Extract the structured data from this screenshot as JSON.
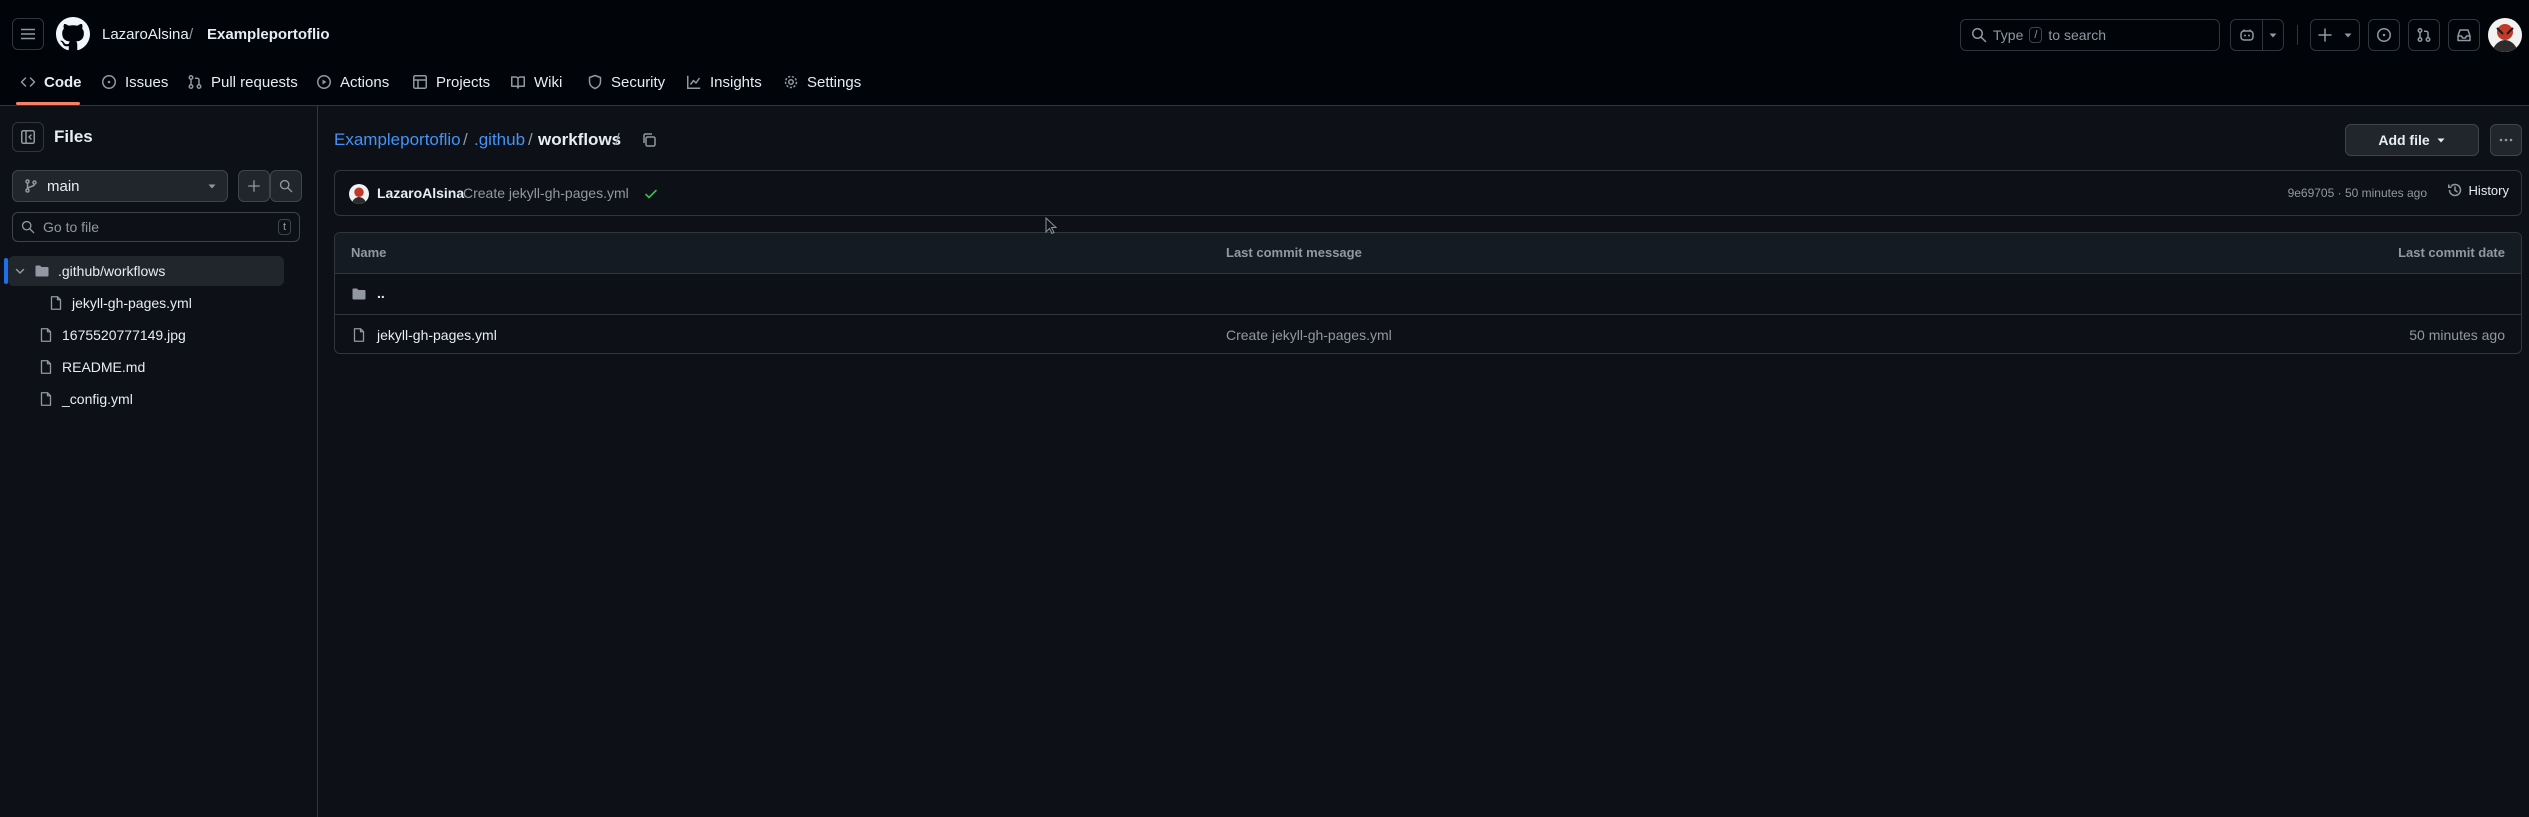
{
  "header": {
    "owner": "LazaroAlsina",
    "separator": "/",
    "repo": "Exampleportoflio",
    "search": {
      "prefix": "Type",
      "key": "/",
      "suffix": "to search"
    }
  },
  "nav": {
    "tabs": [
      {
        "label": "Code",
        "icon": "code-icon"
      },
      {
        "label": "Issues",
        "icon": "issue-icon"
      },
      {
        "label": "Pull requests",
        "icon": "pull-request-icon"
      },
      {
        "label": "Actions",
        "icon": "play-icon"
      },
      {
        "label": "Projects",
        "icon": "table-icon"
      },
      {
        "label": "Wiki",
        "icon": "book-icon"
      },
      {
        "label": "Security",
        "icon": "shield-icon"
      },
      {
        "label": "Insights",
        "icon": "graph-icon"
      },
      {
        "label": "Settings",
        "icon": "gear-icon"
      }
    ],
    "active": "Code"
  },
  "sidebar": {
    "title": "Files",
    "branch": "main",
    "goto_placeholder": "Go to file",
    "goto_key": "t",
    "tree": [
      {
        "name": ".github/workflows",
        "type": "folder",
        "expanded": true,
        "selected": true
      },
      {
        "name": "jekyll-gh-pages.yml",
        "type": "file"
      },
      {
        "name": "1675520777149.jpg",
        "type": "file"
      },
      {
        "name": "README.md",
        "type": "file"
      },
      {
        "name": "_config.yml",
        "type": "file"
      }
    ]
  },
  "breadcrumb": {
    "repo": "Exampleportoflio",
    "sep": "/",
    "dir": ".github",
    "current": "workflows",
    "trailing": "/"
  },
  "actions": {
    "add_file": "Add file"
  },
  "commit": {
    "author": "LazaroAlsina",
    "message": "Create jekyll-gh-pages.yml",
    "sha_time": "9e69705 · 50 minutes ago",
    "history": "History"
  },
  "table": {
    "headers": {
      "name": "Name",
      "message": "Last commit message",
      "date": "Last commit date"
    },
    "parent": "..",
    "rows": [
      {
        "name": "jekyll-gh-pages.yml",
        "message": "Create jekyll-gh-pages.yml",
        "date": "50 minutes ago"
      }
    ]
  },
  "colors": {
    "background": "#0d1117",
    "header_bg": "#010409",
    "border": "#30363d",
    "link": "#4493f8",
    "accent_underline": "#f78166",
    "selected_indicator": "#1f6feb",
    "success": "#3fb950"
  }
}
